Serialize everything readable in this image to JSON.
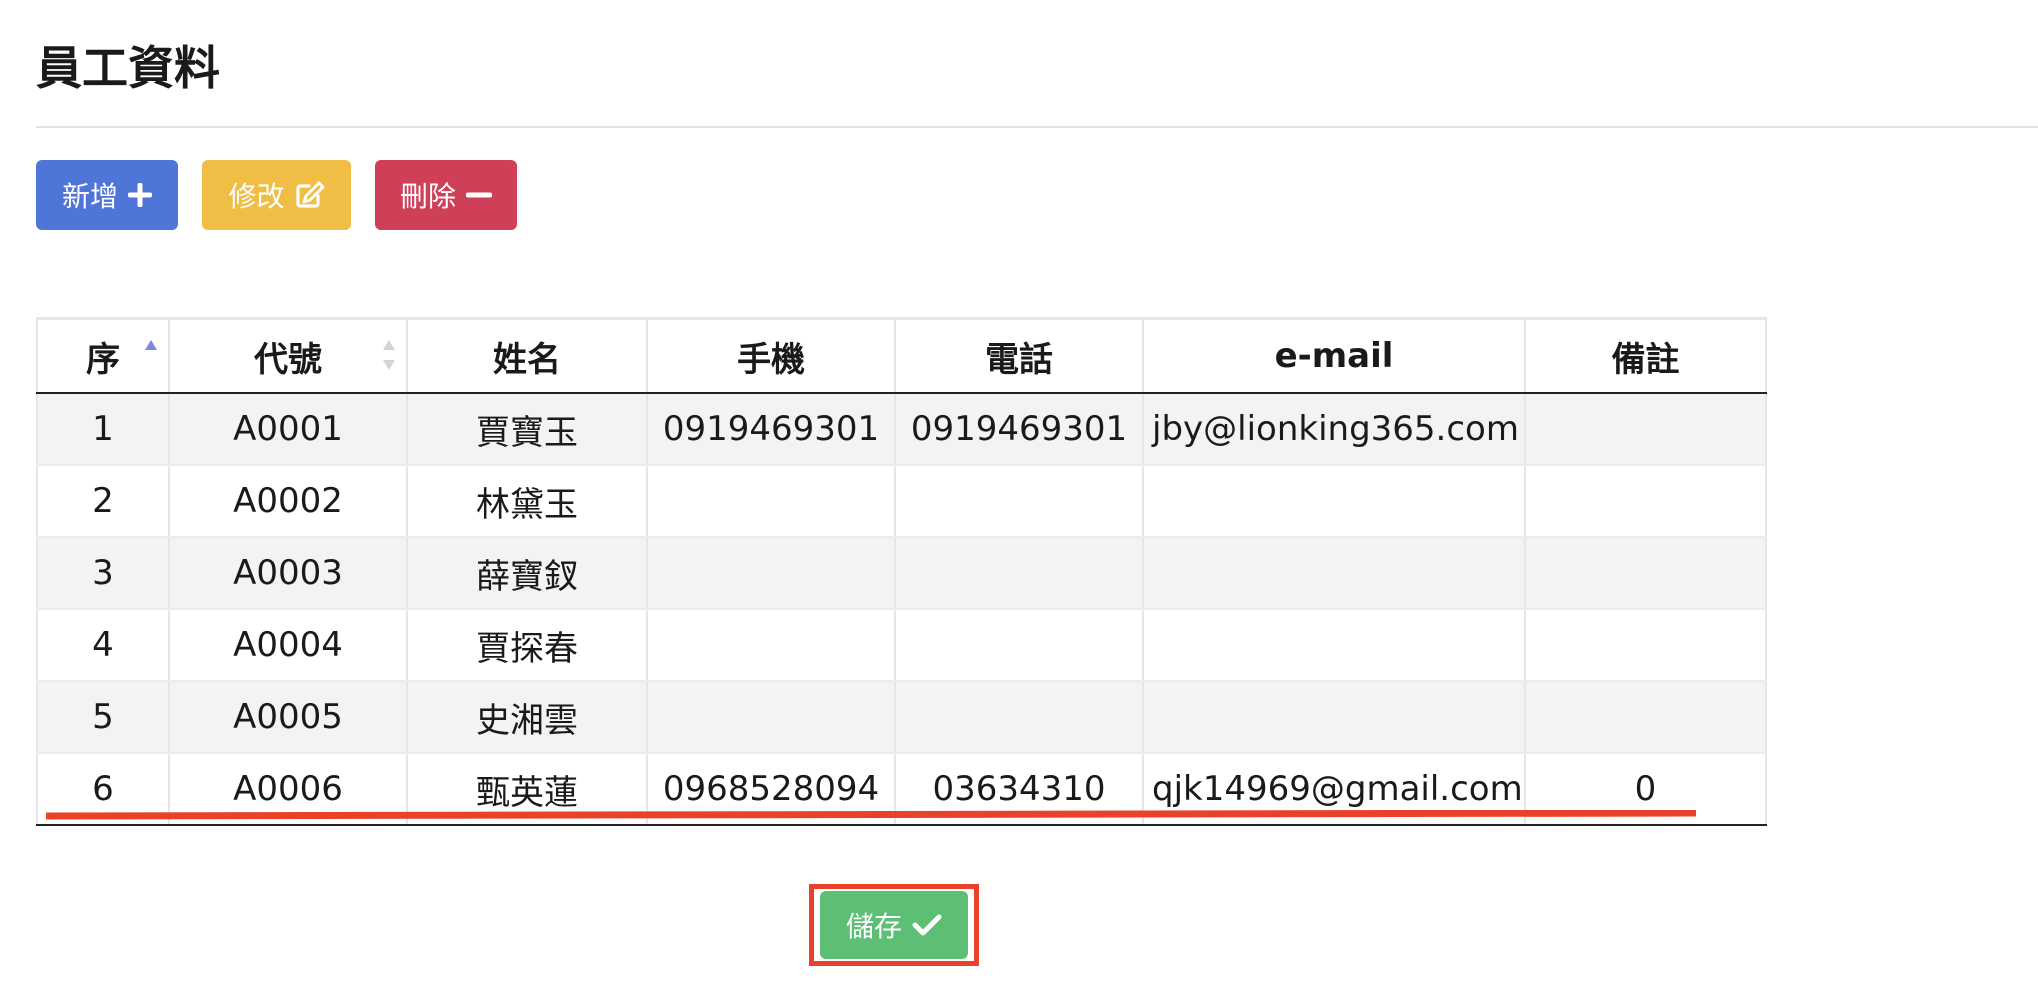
{
  "page": {
    "title": "員工資料"
  },
  "toolbar": {
    "add_label": "新增",
    "edit_label": "修改",
    "delete_label": "刪除",
    "add_icon": "plus-icon",
    "edit_icon": "edit-icon",
    "delete_icon": "minus-icon",
    "colors": {
      "add": "#4f75d8",
      "edit": "#f0bd45",
      "delete": "#cf3f58",
      "save": "#5cbf74",
      "annotation": "#e8432a"
    }
  },
  "table": {
    "columns": [
      "序",
      "代號",
      "姓名",
      "手機",
      "電話",
      "e-mail",
      "備註"
    ],
    "sort": {
      "column_index": 0,
      "direction": "asc"
    },
    "rows": [
      [
        "1",
        "A0001",
        "賈寶玉",
        "0919469301",
        "0919469301",
        "jby@lionking365.com",
        ""
      ],
      [
        "2",
        "A0002",
        "林黛玉",
        "",
        "",
        "",
        ""
      ],
      [
        "3",
        "A0003",
        "薛寶釵",
        "",
        "",
        "",
        ""
      ],
      [
        "4",
        "A0004",
        "賈探春",
        "",
        "",
        "",
        ""
      ],
      [
        "5",
        "A0005",
        "史湘雲",
        "",
        "",
        "",
        ""
      ],
      [
        "6",
        "A0006",
        "甄英蓮",
        "0968528094",
        "03634310",
        "qjk14969@gmail.com",
        "0"
      ]
    ]
  },
  "footer": {
    "save_label": "儲存",
    "save_icon": "check-icon"
  }
}
